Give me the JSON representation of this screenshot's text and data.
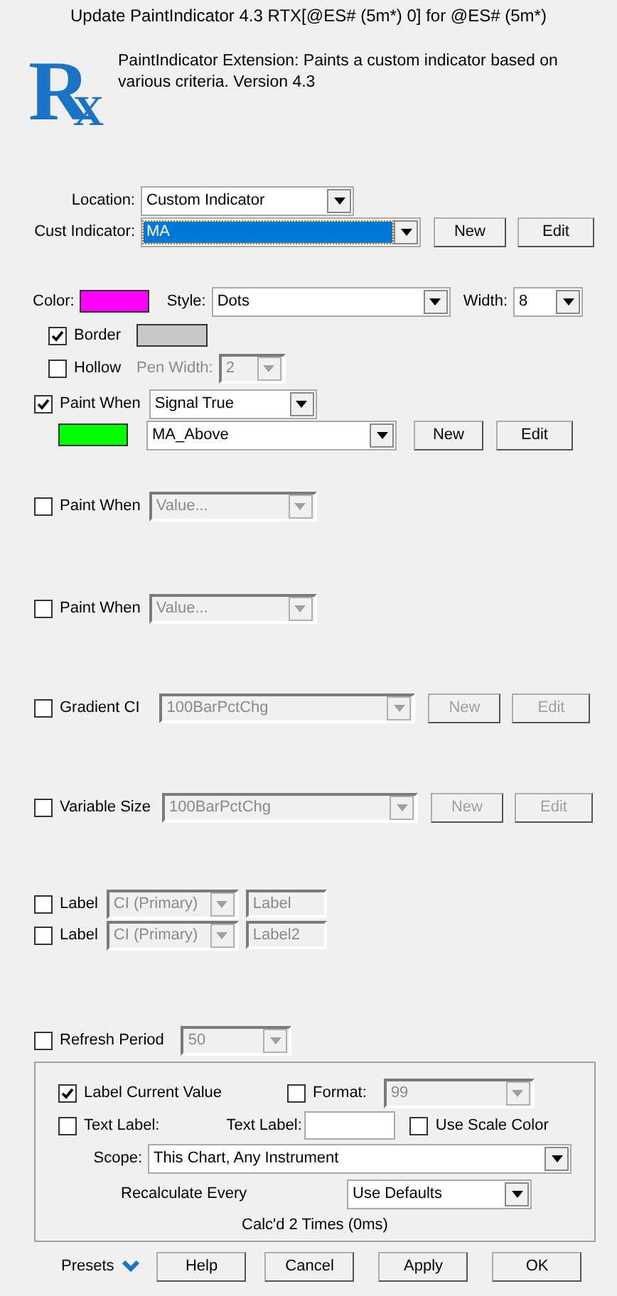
{
  "window": {
    "title": "Update PaintIndicator 4.3 RTX[@ES# (5m*) 0] for @ES# (5m*)"
  },
  "header": {
    "logo_letters": [
      "R",
      "X"
    ],
    "description": "PaintIndicator Extension: Paints a custom indicator based on various criteria. Version 4.3"
  },
  "location": {
    "label": "Location:",
    "value": "Custom Indicator"
  },
  "cust_indicator": {
    "label": "Cust Indicator:",
    "value": "MA",
    "focused": true,
    "buttons": [
      "New",
      "Edit"
    ]
  },
  "color": {
    "label": "Color:",
    "color": "#ff00ff"
  },
  "style": {
    "label": "Style:",
    "value": "Dots"
  },
  "width": {
    "label": "Width:",
    "value": "8"
  },
  "border": {
    "label": "Border",
    "checked": true,
    "color": "#c8c8c8"
  },
  "hollow": {
    "label": "Hollow",
    "checked": false
  },
  "pen_width": {
    "label": "Pen Width:",
    "value": "2",
    "disabled": true
  },
  "paint_when": [
    {
      "label": "Paint When",
      "checked": true,
      "value": "Signal True",
      "disabled": false,
      "color": "#00ff00",
      "indicator": "MA_Above",
      "buttons": [
        "New",
        "Edit"
      ]
    },
    {
      "label": "Paint When",
      "checked": false,
      "value": "Value...",
      "disabled": true
    },
    {
      "label": "Paint When",
      "checked": false,
      "value": "Value...",
      "disabled": true
    }
  ],
  "gradient_ci": {
    "label": "Gradient CI",
    "checked": false,
    "value": "100BarPctChg",
    "disabled": true,
    "buttons": [
      "New",
      "Edit"
    ]
  },
  "variable_size": {
    "label": "Variable Size",
    "checked": false,
    "value": "100BarPctChg",
    "disabled": true,
    "buttons": [
      "New",
      "Edit"
    ]
  },
  "labels": [
    {
      "label": "Label",
      "checked": false,
      "source": "CI (Primary)",
      "text": "Label",
      "disabled": true
    },
    {
      "label": "Label",
      "checked": false,
      "source": "CI (Primary)",
      "text": "Label2",
      "disabled": true
    }
  ],
  "refresh_period": {
    "label": "Refresh Period",
    "checked": false,
    "value": "50",
    "disabled": true
  },
  "display": {
    "label_current_value": {
      "label": "Label Current Value",
      "checked": true
    },
    "format": {
      "label": "Format:",
      "checked": false,
      "value": "99",
      "disabled": true
    },
    "text_label_toggle": {
      "label": "Text Label:",
      "checked": false
    },
    "text_label_field": {
      "label": "Text Label:"
    },
    "use_scale_color": {
      "label": "Use Scale Color",
      "checked": false
    },
    "scope": {
      "label": "Scope:",
      "value": "This Chart, Any Instrument"
    },
    "recalculate": {
      "label": "Recalculate Every",
      "value": "Use Defaults"
    },
    "status": "Calc'd 2 Times (0ms)"
  },
  "footer": {
    "presets": "Presets",
    "buttons": [
      "Help",
      "Cancel",
      "Apply",
      "OK"
    ]
  }
}
